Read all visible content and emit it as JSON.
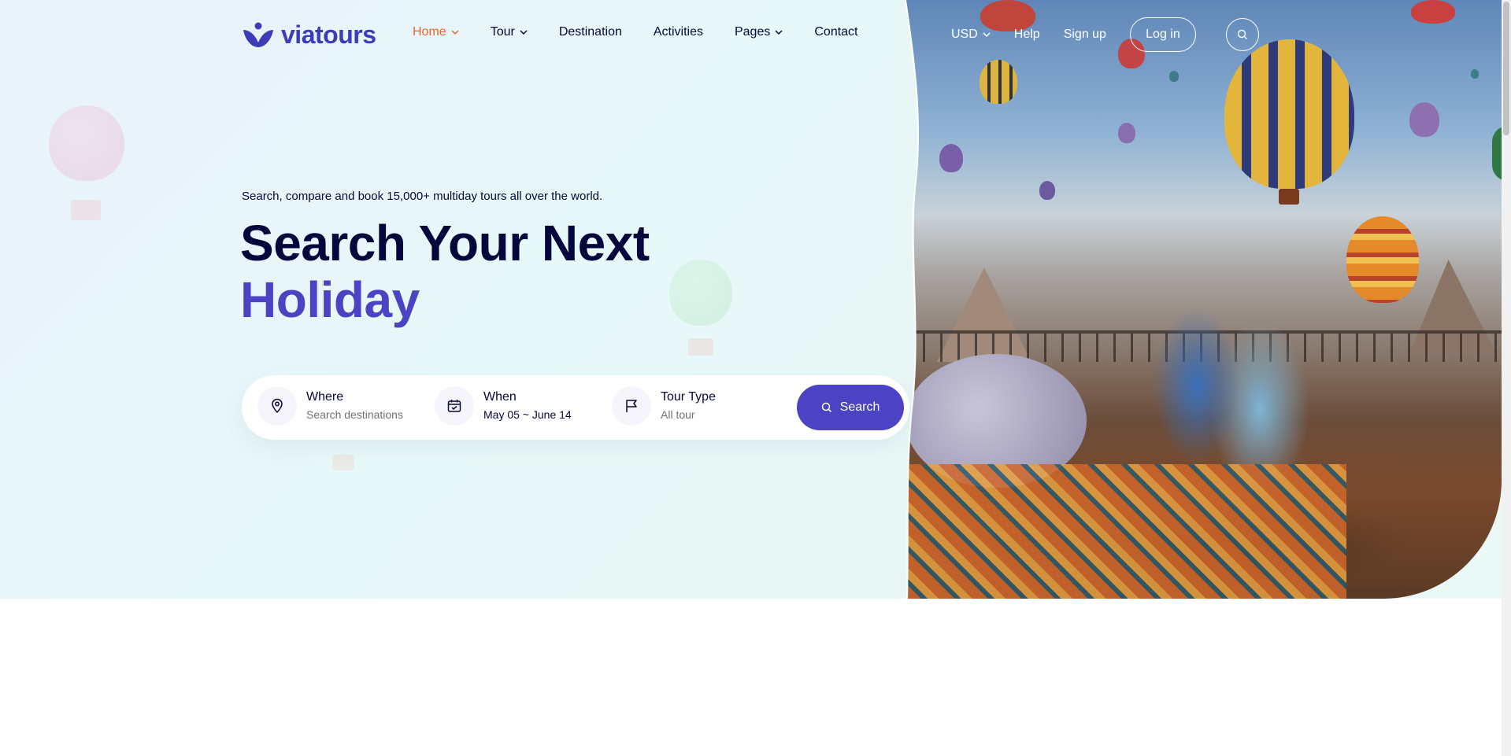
{
  "brand": {
    "name": "viatours",
    "color": "#3e3bb8",
    "accent": "#eb662b",
    "primary": "#4c42c4"
  },
  "nav": {
    "items": [
      {
        "label": "Home",
        "has_dropdown": true,
        "active": true
      },
      {
        "label": "Tour",
        "has_dropdown": true
      },
      {
        "label": "Destination",
        "has_dropdown": false
      },
      {
        "label": "Activities",
        "has_dropdown": false
      },
      {
        "label": "Pages",
        "has_dropdown": true
      },
      {
        "label": "Contact",
        "has_dropdown": false
      }
    ]
  },
  "header_right": {
    "currency": "USD",
    "help": "Help",
    "signup": "Sign up",
    "login": "Log in",
    "search_icon": "search-icon"
  },
  "hero": {
    "subtitle": "Search, compare and book 15,000+ multiday tours all over the world.",
    "title_line1": "Search Your Next",
    "title_line2": "Holiday"
  },
  "search": {
    "where": {
      "label": "Where",
      "placeholder": "Search destinations",
      "icon": "location-pin-icon"
    },
    "when": {
      "label": "When",
      "value": "May 05 ~ June 14",
      "icon": "calendar-icon"
    },
    "tour_type": {
      "label": "Tour Type",
      "value": "All tour",
      "icon": "flag-icon"
    },
    "button": "Search"
  }
}
